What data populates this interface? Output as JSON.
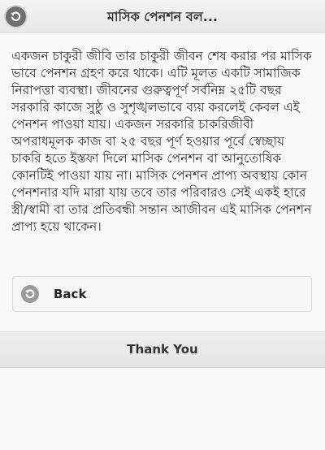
{
  "header": {
    "title": "মাসিক পেনশন বল...",
    "back_icon": "back-arrow-icon"
  },
  "content": {
    "text": "একজন চাকুরী জীবি তার চাকুরী জীবন শেষ করার পর মাসিক ভাবে পেনশন গ্রহণ করে থাকে। এটি মূলত একটি সামাজিক নিরাপত্তা ব্যবস্থা। জীবনের গুরুত্বপূর্ণ সর্বনিম্ন ২৫টি বছর সরকারি কাজে সুষ্ঠু ও সুশৃঙ্খলভাবে ব্যয় করলেই কেবল এই পেনশন পাওয়া যায়। একজন সরকারি চাকরিজীবী অপরাধমূলক কাজ বা ২৫ বছর পূর্ণ হওয়ার পূর্বে স্বেচ্ছায় চাকরি হতে ইস্তফা দিলে মাসিক পেনশন বা আনুতোষিক কোনটিই পাওয়া যায় না। মাসিক পেনশন প্রাপ্য অবস্থায় কোন পেনশনার যদি মারা যায় তবে তার পরিবারও সেই একই হারে স্ত্রী/স্বামী বা তার প্রতিবন্ধী সন্তান আজীবন এই মাসিক পেনশন প্রাপ্য হয়ে থাকেন।"
  },
  "back_button": {
    "label": "Back",
    "icon": "back-arrow-icon"
  },
  "footer": {
    "text": "Thank You"
  },
  "colors": {
    "header_bg": "#ececec",
    "page_bg": "#f9f9f9",
    "icon_dark": "#6f6f6f",
    "icon_light": "#9a9a9a"
  }
}
